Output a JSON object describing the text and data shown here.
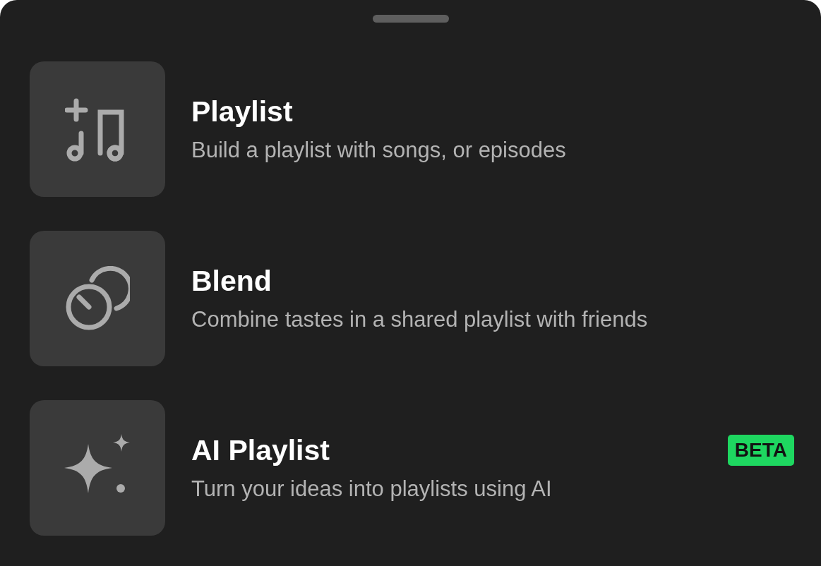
{
  "options": [
    {
      "kind": "playlist",
      "title": "Playlist",
      "subtitle": "Build a playlist with songs, or episodes"
    },
    {
      "kind": "blend",
      "title": "Blend",
      "subtitle": "Combine tastes in a shared playlist with friends"
    },
    {
      "kind": "ai",
      "title": "AI Playlist",
      "subtitle": "Turn your ideas into playlists using AI",
      "badge": "BETA"
    }
  ]
}
